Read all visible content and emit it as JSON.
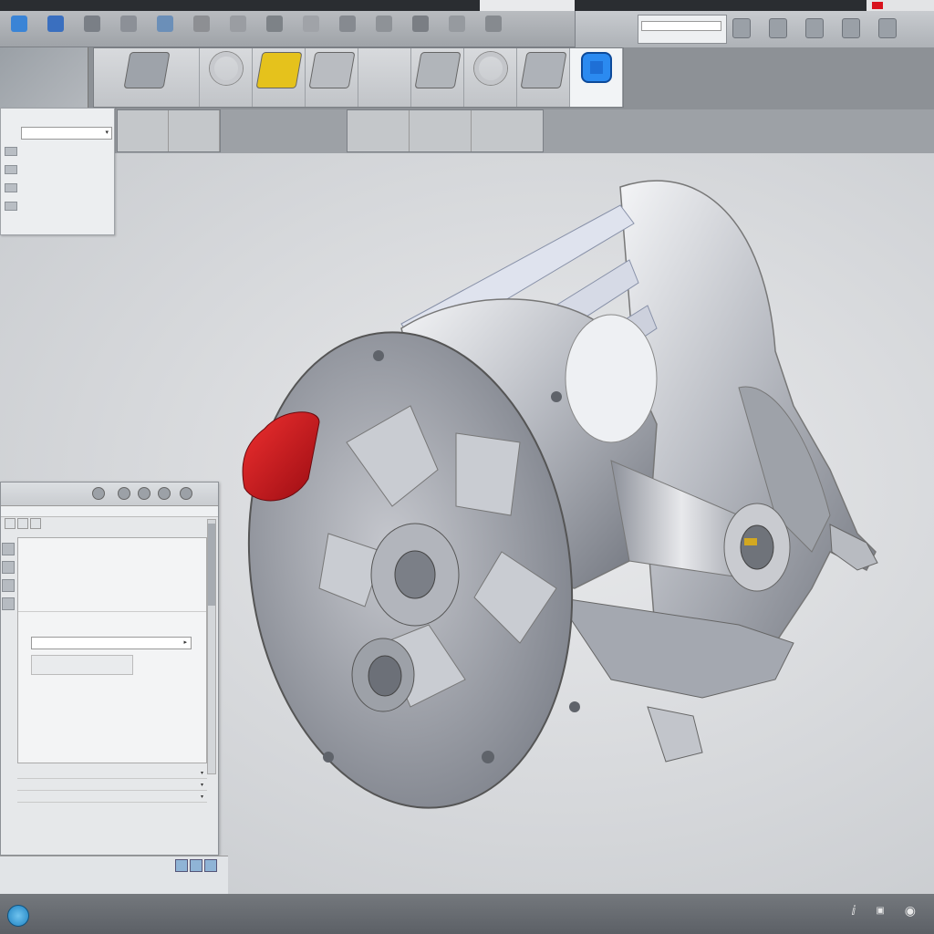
{
  "window": {
    "title": "",
    "accent": "#2f7fd0",
    "highlight_red": "#d8121c"
  },
  "toolbar": {
    "buttons": [
      {
        "icon": "app-icon",
        "label": ""
      },
      {
        "icon": "globe-icon",
        "label": ""
      },
      {
        "icon": "ruler-icon",
        "label": ""
      },
      {
        "icon": "sketch-icon",
        "label": ""
      },
      {
        "icon": "part-icon",
        "label": ""
      },
      {
        "icon": "assembly-icon",
        "label": ""
      },
      {
        "icon": "drawing-icon",
        "label": ""
      },
      {
        "icon": "feature-icon",
        "label": ""
      },
      {
        "icon": "measure-icon",
        "label": ""
      },
      {
        "icon": "render-icon",
        "label": ""
      },
      {
        "icon": "view-icon",
        "label": ""
      },
      {
        "icon": "section-icon",
        "label": ""
      },
      {
        "icon": "material-icon",
        "label": ""
      },
      {
        "icon": "tools-icon",
        "label": ""
      }
    ],
    "search": {
      "title": "",
      "placeholder": ""
    },
    "right_icons": [
      "settings-icon",
      "help-icon",
      "user-icon",
      "cloud-icon",
      "notification-icon"
    ]
  },
  "gallery": {
    "items": [
      {
        "shape": "assembly",
        "caption": "",
        "active": false
      },
      {
        "shape": "ring",
        "caption": "",
        "active": false
      },
      {
        "shape": "bracket-yellow",
        "caption": "",
        "active": false
      },
      {
        "shape": "linkage",
        "caption": "",
        "active": false
      },
      {
        "shape": "blank",
        "caption": "",
        "active": false
      },
      {
        "shape": "frame",
        "caption": "",
        "active": false
      },
      {
        "shape": "gear",
        "caption": "",
        "active": false
      },
      {
        "shape": "housing",
        "caption": "",
        "active": false
      },
      {
        "shape": "blue-part",
        "caption": "",
        "active": true
      }
    ]
  },
  "subribbon": {
    "mid_text": ""
  },
  "tree_panel": {
    "header": "",
    "dropdown": "",
    "rows": [
      "",
      "",
      "",
      ""
    ]
  },
  "properties": {
    "title": "",
    "subtitle": "",
    "tabs": [
      "",
      "",
      ""
    ],
    "rows": [
      "",
      "",
      "",
      ""
    ],
    "section": "",
    "combo_value": "",
    "field_value": "",
    "rows2": [
      "",
      ""
    ],
    "list": [
      "",
      "",
      ""
    ],
    "footer": [
      "",
      ""
    ],
    "bottom_a": "",
    "bottom_b": ""
  },
  "viewport": {
    "cube_label": ""
  }
}
